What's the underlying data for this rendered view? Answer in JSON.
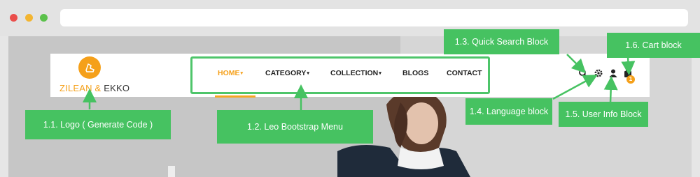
{
  "logo": {
    "primary": "ZILEAN",
    "amp": "&",
    "secondary": "EKKO"
  },
  "menu": {
    "items": [
      {
        "label": "HOME",
        "dropdown": true,
        "active": true
      },
      {
        "label": "CATEGORY",
        "dropdown": true,
        "active": false
      },
      {
        "label": "COLLECTION",
        "dropdown": true,
        "active": false
      },
      {
        "label": "BLOGS",
        "dropdown": false,
        "active": false
      },
      {
        "label": "CONTACT",
        "dropdown": false,
        "active": false
      }
    ],
    "caret": "▾"
  },
  "header_icons": {
    "search": "search-icon",
    "language": "gear-icon",
    "user": "user-icon",
    "cart": "cart-icon",
    "cart_count": "1"
  },
  "callouts": {
    "logo": "1.1. Logo ( Generate Code )",
    "menu": "1.2. Leo Bootstrap Menu",
    "search": "1.3. Quick Search Block",
    "language": "1.4. Language block",
    "user": "1.5. User Info Block",
    "cart": "1.6. Cart block"
  },
  "colors": {
    "accent": "#f5a01a",
    "callout": "#46c261",
    "outline": "#4ec56a"
  }
}
